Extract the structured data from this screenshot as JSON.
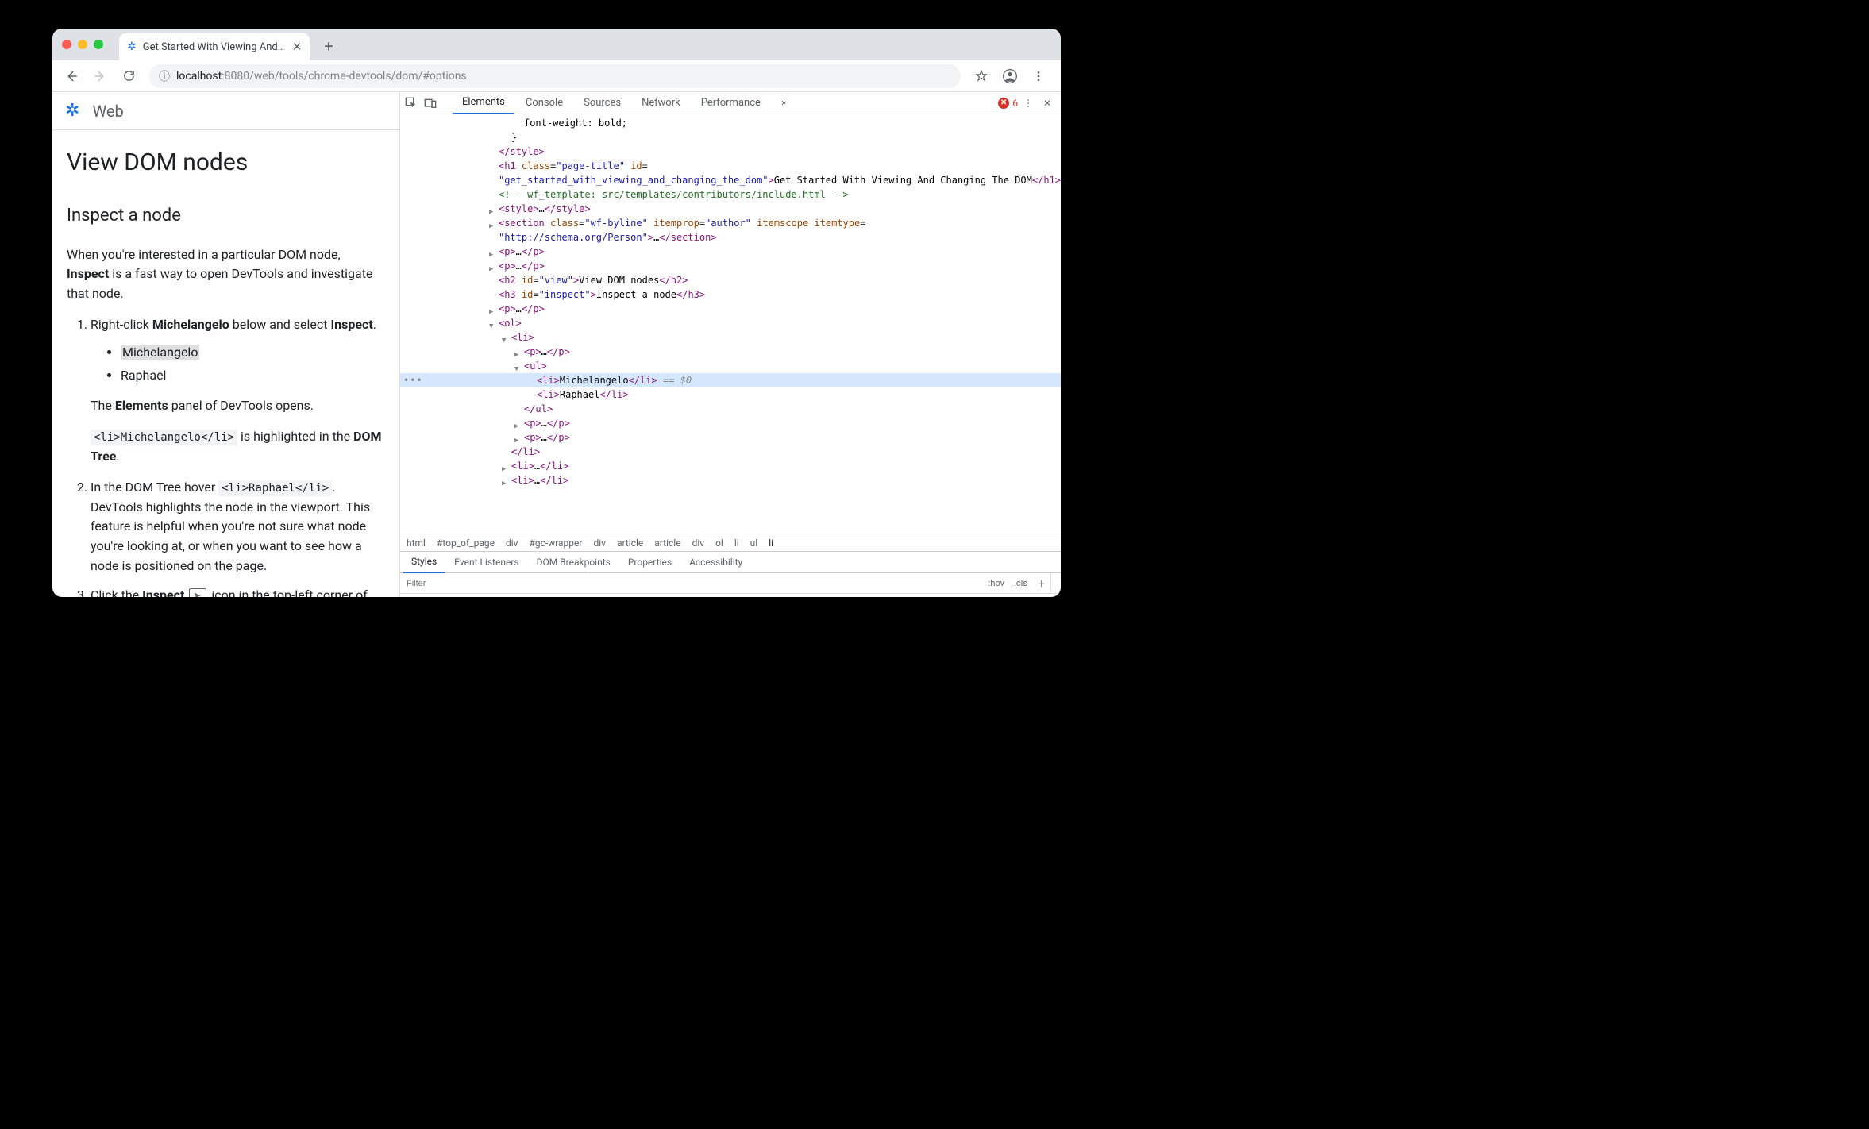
{
  "browser": {
    "tab_title": "Get Started With Viewing And C",
    "url_full": "localhost:8080/web/tools/chrome-devtools/dom/#options",
    "url_host": "localhost",
    "url_port": ":8080",
    "url_path": "/web/tools/chrome-devtools/dom/#options"
  },
  "page": {
    "site_label": "Web",
    "h1": "View DOM nodes",
    "h2": "Inspect a node",
    "intro_pre": "When you're interested in a particular DOM node, ",
    "intro_bold": "Inspect",
    "intro_post": " is a fast way to open DevTools and investigate that node.",
    "step1_pre": "Right-click ",
    "step1_bold": "Michelangelo",
    "step1_mid": " below and select ",
    "step1_bold2": "Inspect",
    "step1_end": ".",
    "bullet1": "Michelangelo",
    "bullet2": "Raphael",
    "step1_after_pre": "The ",
    "step1_after_bold": "Elements",
    "step1_after_post": " panel of DevTools opens.",
    "step1_code": "<li>Michelangelo</li>",
    "step1_code_post_pre": " is highlighted in the ",
    "step1_code_post_bold": "DOM Tree",
    "step1_code_post_end": ".",
    "step2_pre": "In the DOM Tree hover ",
    "step2_code": "<li>Raphael</li>",
    "step2_post": ". DevTools highlights the node in the viewport. This feature is helpful when you're not sure what node you're looking at, or when you want to see how a node is positioned on the page.",
    "step3_pre": "Click the ",
    "step3_bold": "Inspect",
    "step3_post": " icon in the top-left corner of DevTools"
  },
  "devtools": {
    "tabs": [
      "Elements",
      "Console",
      "Sources",
      "Network",
      "Performance"
    ],
    "more": "»",
    "error_count": "6",
    "breadcrumbs": [
      "html",
      "#top_of_page",
      "div",
      "#gc-wrapper",
      "div",
      "article",
      "article",
      "div",
      "ol",
      "li",
      "ul",
      "li"
    ],
    "subtabs": [
      "Styles",
      "Event Listeners",
      "DOM Breakpoints",
      "Properties",
      "Accessibility"
    ],
    "filter_placeholder": "Filter",
    "hov": ":hov",
    "cls": ".cls",
    "dom": {
      "fw": "font-weight: bold;",
      "close_style": "</style>",
      "h1_open": "<h1 class=\"page-title\" id=",
      "h1_id": "\"get_started_with_viewing_and_changing_the_dom\"",
      "h1_text": "Get Started With Viewing And Changing The DOM",
      "h1_close": "</h1>",
      "comment": "<!-- wf_template: src/templates/contributors/include.html -->",
      "style_coll": "<style>…</style>",
      "section_open": "<section class=\"wf-byline\" itemprop=\"author\" itemscope itemtype=",
      "section_url": "\"http://schema.org/Person\"",
      "section_mid": ">…</section>",
      "p_coll": "<p>…</p>",
      "h2": "View DOM nodes",
      "h3": "Inspect a node",
      "li_mich": "Michelangelo",
      "li_raph": "Raphael",
      "eq0": " == $0"
    }
  }
}
